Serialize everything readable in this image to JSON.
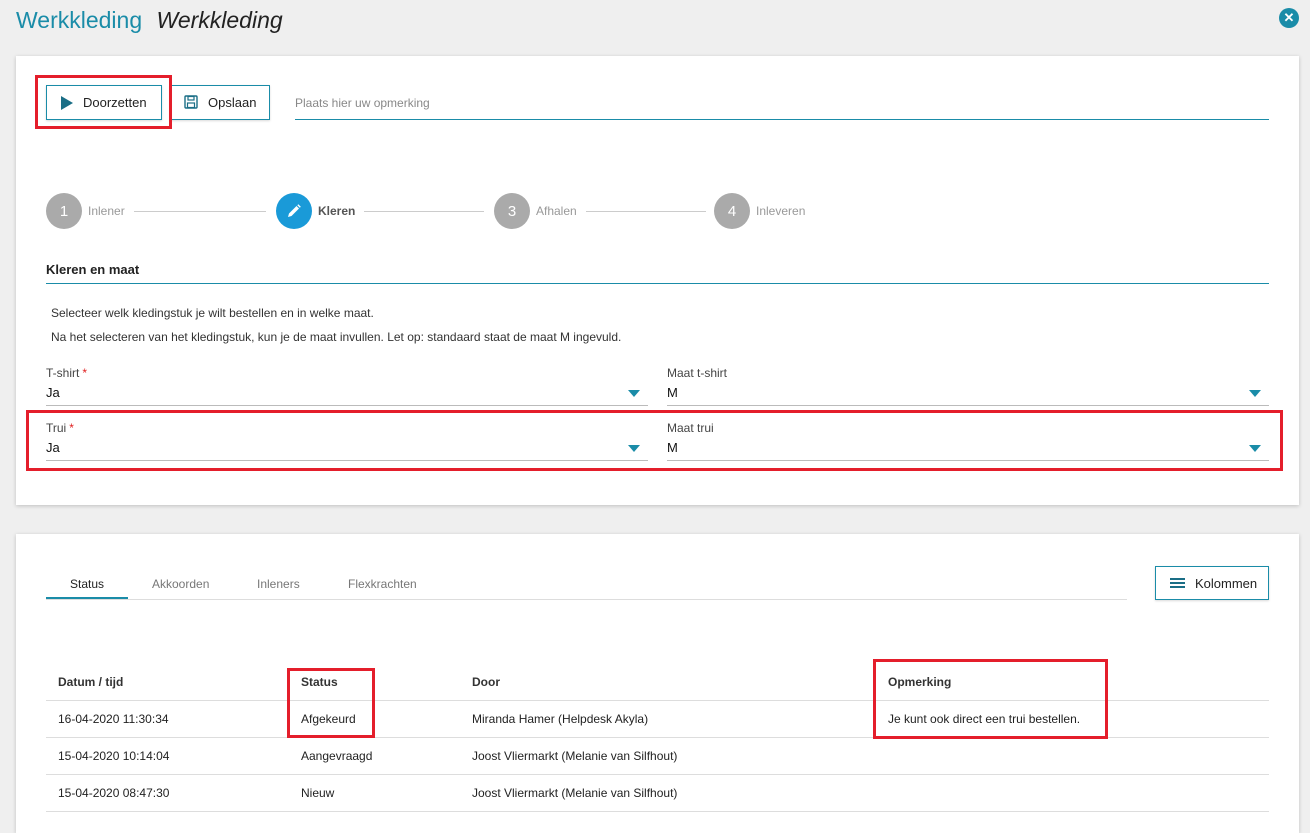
{
  "header": {
    "app_title": "Werkkleding",
    "page_title": "Werkkleding",
    "close_label": "✕"
  },
  "toolbar": {
    "doorzetten_label": "Doorzetten",
    "opslaan_label": "Opslaan",
    "remark_placeholder": "Plaats hier uw opmerking"
  },
  "stepper": {
    "steps": [
      {
        "number": "1",
        "label": "Inlener",
        "state": "inactive"
      },
      {
        "number": "✎",
        "label": "Kleren",
        "state": "active"
      },
      {
        "number": "3",
        "label": "Afhalen",
        "state": "inactive"
      },
      {
        "number": "4",
        "label": "Inleveren",
        "state": "inactive"
      }
    ]
  },
  "form": {
    "section_title": "Kleren en maat",
    "intro_line1": "Selecteer welk kledingstuk je wilt bestellen en in welke maat.",
    "intro_line2": "Na het selecteren van het kledingstuk, kun je de maat invullen. Let op: standaard staat de maat M ingevuld.",
    "tshirt": {
      "label": "T-shirt",
      "required_mark": "*",
      "value": "Ja"
    },
    "maat_tshirt": {
      "label": "Maat t-shirt",
      "value": "M"
    },
    "trui": {
      "label": "Trui",
      "required_mark": "*",
      "value": "Ja"
    },
    "maat_trui": {
      "label": "Maat trui",
      "value": "M"
    }
  },
  "history": {
    "tabs": [
      "Status",
      "Akkoorden",
      "Inleners",
      "Flexkrachten"
    ],
    "active_tab": "Status",
    "kolommen_label": "Kolommen",
    "columns": [
      "Datum / tijd",
      "Status",
      "Door",
      "Opmerking"
    ],
    "rows": [
      {
        "datum": "16-04-2020 11:30:34",
        "status": "Afgekeurd",
        "door": "Miranda Hamer (Helpdesk Akyla)",
        "opmerking": "Je kunt ook direct een trui bestellen."
      },
      {
        "datum": "15-04-2020 10:14:04",
        "status": "Aangevraagd",
        "door": "Joost Vliermarkt (Melanie van Silfhout)",
        "opmerking": ""
      },
      {
        "datum": "15-04-2020 08:47:30",
        "status": "Nieuw",
        "door": "Joost Vliermarkt (Melanie van Silfhout)",
        "opmerking": ""
      }
    ]
  },
  "colors": {
    "accent": "#1a8ca8",
    "active_step": "#1a9ad8",
    "highlight": "#e41e2b"
  }
}
